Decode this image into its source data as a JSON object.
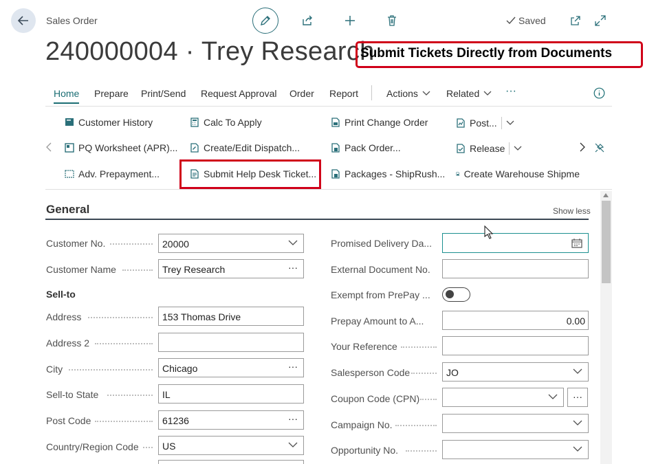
{
  "header": {
    "breadcrumb": "Sales Order",
    "title": "240000004 · Trey Research",
    "saved_label": "Saved",
    "banner": "Submit Tickets Directly from Documents"
  },
  "menu": {
    "items": [
      "Home",
      "Prepare",
      "Print/Send",
      "Request Approval",
      "Order",
      "Report",
      "Actions",
      "Related"
    ],
    "more": "···"
  },
  "actions": {
    "col1": [
      "Customer History",
      "PQ Worksheet (APR)...",
      "Adv. Prepayment..."
    ],
    "col2": [
      "Calc To Apply",
      "Create/Edit Dispatch...",
      "Submit Help Desk Ticket..."
    ],
    "col3": [
      "Print Change Order",
      "Pack Order...",
      "Packages - ShipRush..."
    ],
    "col4": [
      "Post...",
      "Release",
      "Create Warehouse Shipme"
    ]
  },
  "general": {
    "title": "General",
    "show_less": "Show less",
    "sell_to_heading": "Sell-to",
    "left_fields": [
      {
        "label": "Customer No.",
        "value": "20000"
      },
      {
        "label": "Customer Name",
        "value": "Trey Research"
      },
      {
        "label": "Address",
        "value": "153 Thomas Drive"
      },
      {
        "label": "Address 2",
        "value": ""
      },
      {
        "label": "City",
        "value": "Chicago"
      },
      {
        "label": "Sell-to State",
        "value": "IL"
      },
      {
        "label": "Post Code",
        "value": "61236"
      },
      {
        "label": "Country/Region Code",
        "value": "US"
      }
    ],
    "right_fields": [
      {
        "label": "Promised Delivery Da...",
        "value": ""
      },
      {
        "label": "External Document No.",
        "value": ""
      },
      {
        "label": "Exempt from PrePay ...",
        "value": ""
      },
      {
        "label": "Prepay Amount to A...",
        "value": "0.00"
      },
      {
        "label": "Your Reference",
        "value": ""
      },
      {
        "label": "Salesperson Code",
        "value": "JO"
      },
      {
        "label": "Coupon Code (CPN)",
        "value": ""
      },
      {
        "label": "Campaign No.",
        "value": ""
      },
      {
        "label": "Opportunity No.",
        "value": ""
      }
    ],
    "ellipsis": "···"
  },
  "colors": {
    "accent": "#1a6d73",
    "highlight": "#d00019"
  }
}
